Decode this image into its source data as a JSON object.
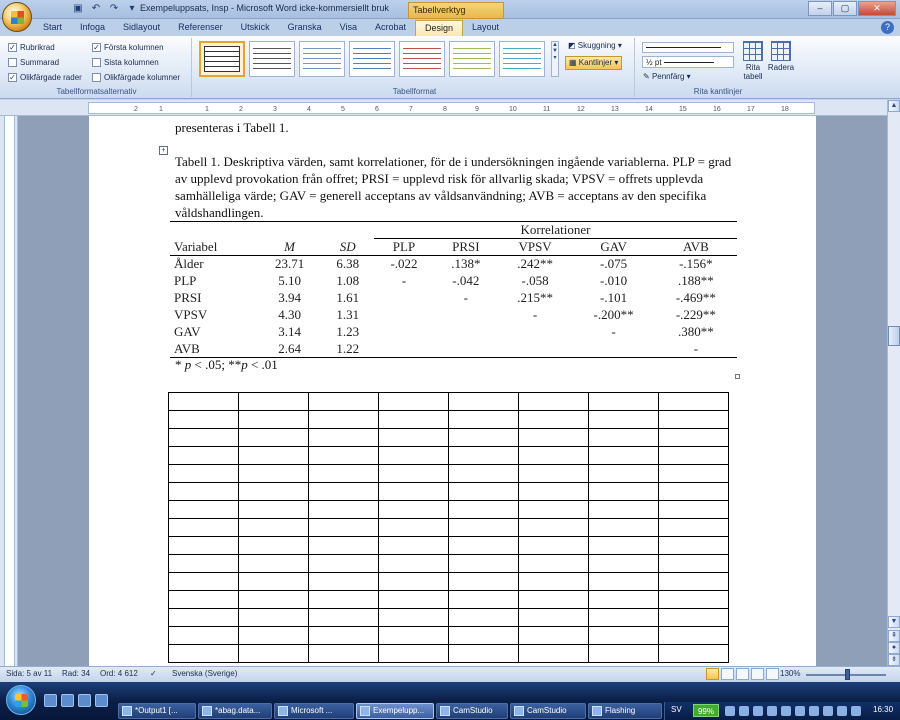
{
  "window": {
    "title": "Exempeluppsats, Insp - Microsoft Word icke-kommersiellt bruk",
    "tool_tab": "Tabellverktyg",
    "controls": [
      "–",
      "▢",
      "✕"
    ]
  },
  "tabs": [
    "Start",
    "Infoga",
    "Sidlayout",
    "Referenser",
    "Utskick",
    "Granska",
    "Visa",
    "Acrobat",
    "Design",
    "Layout"
  ],
  "active_tab": "Design",
  "ribbon": {
    "style_options": {
      "label": "Tabellformatsalternativ",
      "options": [
        {
          "label": "Rubrikrad",
          "checked": true
        },
        {
          "label": "Första kolumnen",
          "checked": true
        },
        {
          "label": "Summarad",
          "checked": false
        },
        {
          "label": "Sista kolumnen",
          "checked": false
        },
        {
          "label": "Olikfärgade rader",
          "checked": true
        },
        {
          "label": "Olikfärgade kolumner",
          "checked": false
        }
      ]
    },
    "styles": {
      "label": "Tabellformat",
      "shading": "Skuggning",
      "borders": "Kantlinjer"
    },
    "draw_borders": {
      "label": "Rita kantlinjer",
      "pen_weight": "½ pt",
      "pen_color": "Pennfärg",
      "draw_table": "Rita tabell",
      "eraser": "Radera"
    }
  },
  "ruler": {
    "ticks": [
      "2",
      "1",
      "1",
      "2",
      "3",
      "4",
      "5",
      "6",
      "7",
      "8",
      "9",
      "10",
      "11",
      "12",
      "13",
      "14",
      "15",
      "16",
      "17",
      "18"
    ]
  },
  "document": {
    "first_line": "presenteras i Tabell 1.",
    "caption": "Tabell 1. Deskriptiva värden, samt korrelationer, för de i undersökningen ingående variablerna. PLP = grad av upplevd provokation från offret; PRSI = upplevd risk för allvarlig skada; VPSV = offrets upplevda samhälleliga värde; GAV = generell acceptans av våldsanvändning; AVB = acceptans av den specifika våldshandlingen.",
    "table": {
      "group_header": "Korrelationer",
      "columns": [
        "Variabel",
        "M",
        "SD",
        "PLP",
        "PRSI",
        "VPSV",
        "GAV",
        "AVB"
      ],
      "rows": [
        [
          "Ålder",
          "23.71",
          "6.38",
          "-.022",
          ".138*",
          ".242**",
          "-.075",
          "-.156*"
        ],
        [
          "PLP",
          "5.10",
          "1.08",
          "-",
          "-.042",
          "-.058",
          "-.010",
          ".188**"
        ],
        [
          "PRSI",
          "3.94",
          "1.61",
          "",
          "-",
          ".215**",
          "-.101",
          "-.469**"
        ],
        [
          "VPSV",
          "4.30",
          "1.31",
          "",
          "",
          "-",
          "-.200**",
          "-.229**"
        ],
        [
          "GAV",
          "3.14",
          "1.23",
          "",
          "",
          "",
          "-",
          ".380**"
        ],
        [
          "AVB",
          "2.64",
          "1.22",
          "",
          "",
          "",
          "",
          "-"
        ]
      ]
    },
    "note_star": "* ",
    "note_p1": "p",
    "note_mid": " < .05; **",
    "note_p2": "p",
    "note_end": " < .01",
    "empty_grid": {
      "rows": 15,
      "cols": 8
    }
  },
  "statusbar": {
    "page": "Sida: 5 av 11",
    "line": "Rad: 34",
    "words": "Ord: 4 612",
    "language": "Svenska (Sverige)",
    "zoom": "130%"
  },
  "taskbar": {
    "tasks": [
      {
        "label": "*Output1 [...",
        "active": false
      },
      {
        "label": "*abag.data...",
        "active": false
      },
      {
        "label": "Microsoft ...",
        "active": false
      },
      {
        "label": "Exempelupp...",
        "active": true
      },
      {
        "label": "CamStudio",
        "active": false
      },
      {
        "label": "CamStudio",
        "active": false
      },
      {
        "label": "Flashing",
        "active": false
      }
    ],
    "language": "SV",
    "battery": "99%",
    "clock": "16:30"
  }
}
